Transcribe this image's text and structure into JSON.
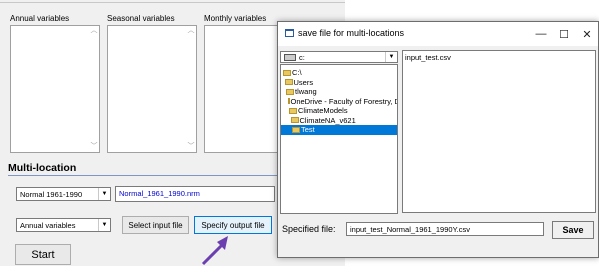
{
  "main": {
    "columns": {
      "annual": "Annual variables",
      "seasonal": "Seasonal variables",
      "monthly": "Monthly variables"
    },
    "section_title": "Multi-location",
    "normal_select": "Normal 1961-1990",
    "normal_file": "Normal_1961_1990.nrm",
    "variables_select": "Annual variables",
    "select_input_button": "Select input file",
    "specify_output_button": "Specify output file",
    "start_button": "Start"
  },
  "dialog": {
    "title": "save file for multi-locations",
    "controls": {
      "minimize": "—",
      "maximize": "☐",
      "close": "✕"
    },
    "drive": "c:",
    "folders": [
      {
        "label": "C:\\",
        "selected": false,
        "indent": 0
      },
      {
        "label": "Users",
        "selected": false,
        "indent": 1
      },
      {
        "label": "tlwang",
        "selected": false,
        "indent": 2
      },
      {
        "label": "OneDrive - Faculty of Forestry, De",
        "selected": false,
        "indent": 3
      },
      {
        "label": "ClimateModels",
        "selected": false,
        "indent": 4
      },
      {
        "label": "ClimateNA_v621",
        "selected": false,
        "indent": 5
      },
      {
        "label": "Test",
        "selected": true,
        "indent": 6
      }
    ],
    "files": [
      "input_test.csv"
    ],
    "specified_label": "Specified file:",
    "specified_value": "input_test_Normal_1961_1990Y.csv",
    "save_button": "Save"
  },
  "colors": {
    "accent": "#0078d7",
    "section_underline": "#7e97c5",
    "arrow": "#6c3fb0"
  }
}
